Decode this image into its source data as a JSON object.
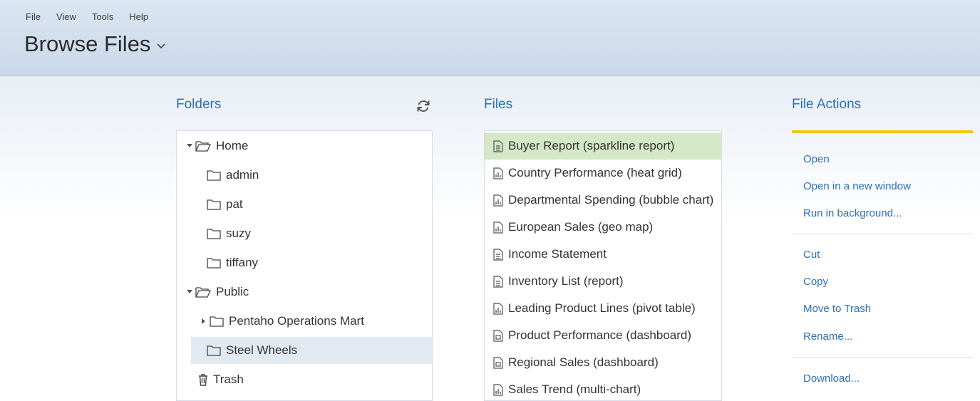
{
  "menu": [
    "File",
    "View",
    "Tools",
    "Help"
  ],
  "page_title": "Browse Files",
  "folders": {
    "title": "Folders",
    "items": [
      {
        "label": "Home",
        "expanded": true,
        "level": 0
      },
      {
        "label": "admin",
        "level": 1
      },
      {
        "label": "pat",
        "level": 1
      },
      {
        "label": "suzy",
        "level": 1
      },
      {
        "label": "tiffany",
        "level": 1
      },
      {
        "label": "Public",
        "expanded": true,
        "level": 0
      },
      {
        "label": "Pentaho Operations Mart",
        "collapsed": true,
        "level": 1
      },
      {
        "label": "Steel Wheels",
        "level": 1,
        "selected": true
      },
      {
        "label": "Trash",
        "level": 0
      }
    ]
  },
  "files": {
    "title": "Files",
    "items": [
      {
        "label": "Buyer Report (sparkline report)",
        "icon": "report-icon",
        "selected": true
      },
      {
        "label": "Country Performance (heat grid)",
        "icon": "analysis-icon"
      },
      {
        "label": "Departmental Spending (bubble chart)",
        "icon": "analysis-icon"
      },
      {
        "label": "European Sales (geo map)",
        "icon": "analysis-icon"
      },
      {
        "label": "Income Statement",
        "icon": "report-icon"
      },
      {
        "label": "Inventory List (report)",
        "icon": "report-icon"
      },
      {
        "label": "Leading Product Lines (pivot table)",
        "icon": "analysis-icon"
      },
      {
        "label": "Product Performance (dashboard)",
        "icon": "dashboard-icon"
      },
      {
        "label": "Regional Sales (dashboard)",
        "icon": "dashboard-icon"
      },
      {
        "label": "Sales Trend (multi-chart)",
        "icon": "analysis-icon"
      }
    ]
  },
  "file_actions": {
    "title": "File Actions",
    "groups": [
      [
        "Open",
        "Open in a new window",
        "Run in background..."
      ],
      [
        "Cut",
        "Copy",
        "Move to Trash",
        "Rename..."
      ],
      [
        "Download..."
      ]
    ]
  },
  "colors": {
    "accent": "#2e6fb5",
    "selected_file": "#d4e8c8",
    "selected_folder": "#e3e9f1",
    "actions_bar": "#f5c800"
  }
}
